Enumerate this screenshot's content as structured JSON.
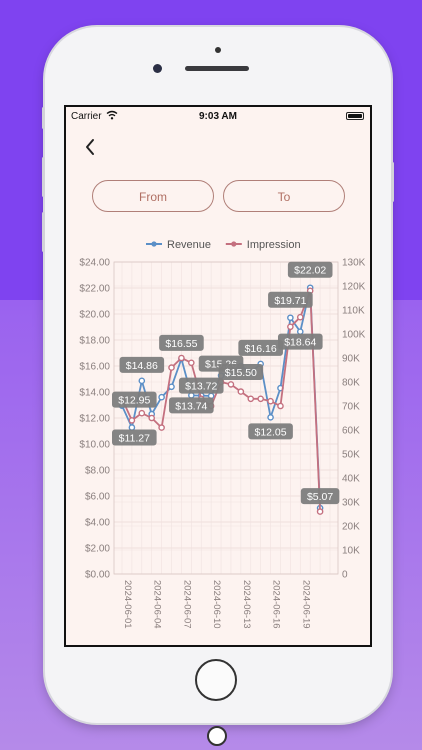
{
  "status_bar": {
    "carrier": "Carrier",
    "time": "9:03 AM"
  },
  "nav": {
    "back_icon": "chevron-left-icon"
  },
  "filters": {
    "from_label": "From",
    "to_label": "To"
  },
  "colors": {
    "revenue": "#5b8fc7",
    "impression": "#c4707f",
    "label_bg": "#7d7d7d"
  },
  "chart_data": {
    "type": "line",
    "x": [
      "2024-06-01",
      "2024-06-02",
      "2024-06-03",
      "2024-06-04",
      "2024-06-05",
      "2024-06-06",
      "2024-06-07",
      "2024-06-08",
      "2024-06-09",
      "2024-06-10",
      "2024-06-11",
      "2024-06-12",
      "2024-06-13",
      "2024-06-14",
      "2024-06-15",
      "2024-06-16",
      "2024-06-17",
      "2024-06-18",
      "2024-06-19",
      "2024-06-20",
      "2024-06-21",
      "2024-06-22"
    ],
    "x_tick_labels": [
      "2024-06-01",
      "2024-06-04",
      "2024-06-07",
      "2024-06-10",
      "2024-06-13",
      "2024-06-16",
      "2024-06-19"
    ],
    "series": [
      {
        "name": "Revenue",
        "axis": "left",
        "values": [
          12.95,
          11.27,
          14.86,
          12.3,
          13.6,
          14.4,
          16.55,
          13.74,
          13.72,
          13.7,
          15.26,
          15.5,
          16.0,
          15.5,
          16.16,
          12.05,
          14.3,
          19.71,
          18.64,
          22.02,
          5.07,
          null
        ],
        "labels": [
          {
            "index": 0,
            "text": "$12.95"
          },
          {
            "index": 1,
            "text": "$11.27"
          },
          {
            "index": 2,
            "text": "$14.86"
          },
          {
            "index": 6,
            "text": "$16.55"
          },
          {
            "index": 7,
            "text": "$13.74"
          },
          {
            "index": 8,
            "text": "$13.72"
          },
          {
            "index": 10,
            "text": "$15.26"
          },
          {
            "index": 12,
            "text": "$15.50"
          },
          {
            "index": 14,
            "text": "$16.16"
          },
          {
            "index": 15,
            "text": "$12.05"
          },
          {
            "index": 17,
            "text": "$19.71"
          },
          {
            "index": 18,
            "text": "$18.64"
          },
          {
            "index": 19,
            "text": "$22.02"
          },
          {
            "index": 20,
            "text": "$5.07"
          }
        ]
      },
      {
        "name": "Impression",
        "axis": "right",
        "values": [
          73000,
          64000,
          67000,
          65000,
          61000,
          86000,
          90000,
          88000,
          73000,
          70000,
          80000,
          79000,
          76000,
          73000,
          73000,
          72000,
          70000,
          103000,
          107000,
          118000,
          26000,
          null
        ]
      }
    ],
    "y_left": {
      "min": 0,
      "max": 24,
      "ticks": [
        "$0.00",
        "$2.00",
        "$4.00",
        "$6.00",
        "$8.00",
        "$10.00",
        "$12.00",
        "$14.00",
        "$16.00",
        "$18.00",
        "$20.00",
        "$22.00",
        "$24.00"
      ]
    },
    "y_right": {
      "min": 0,
      "max": 130000,
      "ticks": [
        "0",
        "10K",
        "20K",
        "30K",
        "40K",
        "50K",
        "60K",
        "70K",
        "80K",
        "90K",
        "100K",
        "110K",
        "120K",
        "130K"
      ]
    },
    "legend_position": "top-center",
    "grid": true
  }
}
